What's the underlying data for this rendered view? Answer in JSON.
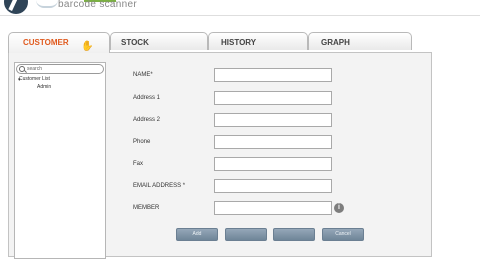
{
  "logo": {
    "tagline": "barcode scanner"
  },
  "tabs": [
    {
      "label": "CUSTOMER"
    },
    {
      "label": "STOCK"
    },
    {
      "label": "HISTORY"
    },
    {
      "label": "GRAPH"
    }
  ],
  "sidebar": {
    "search_placeholder": "search",
    "tree": {
      "root_label": "Customer List",
      "child_label": "Admin"
    }
  },
  "form": {
    "fields": [
      {
        "label": "NAME*",
        "value": ""
      },
      {
        "label": "Address 1",
        "value": ""
      },
      {
        "label": "Address 2",
        "value": ""
      },
      {
        "label": "Phone",
        "value": ""
      },
      {
        "label": "Fax",
        "value": ""
      },
      {
        "label": "EMAIL ADDRESS *",
        "value": ""
      },
      {
        "label": "MEMBER",
        "value": ""
      }
    ],
    "info_icon": "i"
  },
  "actions": [
    {
      "label": "Add"
    },
    {
      "label": ""
    },
    {
      "label": ""
    },
    {
      "label": "Cancel"
    }
  ]
}
